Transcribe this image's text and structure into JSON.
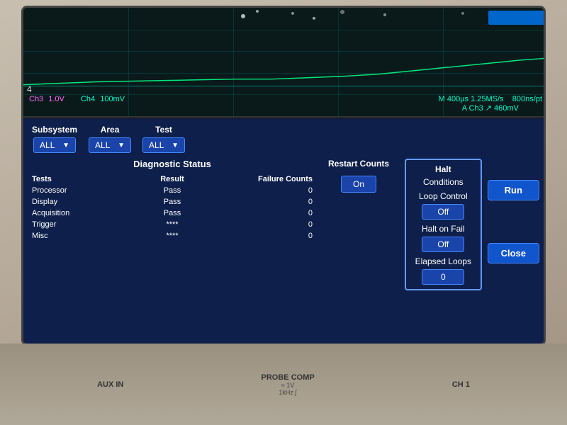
{
  "waveform": {
    "time_div": "M 400µs 1.25MS/s",
    "ns_per_pt": "800ns/pt",
    "trigger_info": "A Ch3 ↗ 460mV",
    "ch3_label": "Ch3",
    "ch3_value": "1.0V",
    "ch4_label": "Ch4",
    "ch4_value": "100mV",
    "four_marker": "4"
  },
  "controls": {
    "subsystem_label": "Subsystem",
    "area_label": "Area",
    "test_label": "Test",
    "subsystem_value": "ALL",
    "area_value": "ALL",
    "test_value": "ALL",
    "dropdown_arrow": "▼"
  },
  "diagnostic": {
    "title": "Diagnostic Status",
    "headers": {
      "tests": "Tests",
      "result": "Result",
      "failure_counts": "Failure Counts"
    },
    "rows": [
      {
        "test": "Processor",
        "result": "Pass",
        "count": "0"
      },
      {
        "test": "Display",
        "result": "Pass",
        "count": "0"
      },
      {
        "test": "Acquisition",
        "result": "Pass",
        "count": "0"
      },
      {
        "test": "Trigger",
        "result": "****",
        "count": "0"
      },
      {
        "test": "Misc",
        "result": "****",
        "count": "0"
      }
    ]
  },
  "restart": {
    "label": "Restart Counts",
    "button_label": "On"
  },
  "halt_conditions": {
    "title": "Halt",
    "subtitle": "Conditions",
    "loop_control_label": "Loop Control",
    "loop_control_value": "Off",
    "halt_on_fail_label": "Halt on Fail",
    "halt_on_fail_value": "Off",
    "elapsed_loops_label": "Elapsed Loops",
    "elapsed_loops_value": "0"
  },
  "buttons": {
    "run": "Run",
    "close": "Close"
  },
  "bottom": {
    "aux_in": "AUX IN",
    "probe_comp": "PROBE COMP",
    "probe_comp_sub": "≈ 1V\n1kHz ∫",
    "ch1": "CH 1"
  }
}
